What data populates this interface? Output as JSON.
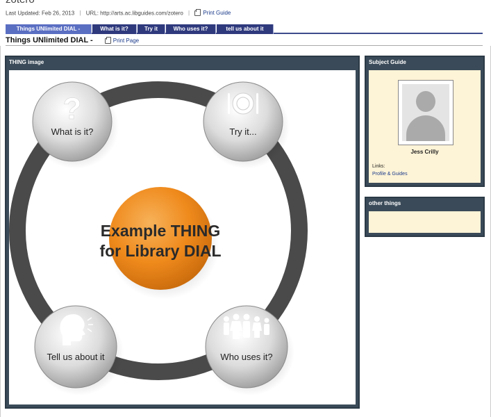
{
  "page": {
    "title": "zotero",
    "last_updated": "Last Updated: Feb 26, 2013",
    "url": "URL: http://arts.ac.libguides.com/zotero",
    "print_guide": "Print Guide"
  },
  "tabs": [
    {
      "label": "Things UNlimited DIAL -",
      "active": true
    },
    {
      "label": "What is it?",
      "active": false
    },
    {
      "label": "Try it",
      "active": false
    },
    {
      "label": "Who uses it?",
      "active": false
    },
    {
      "label": "tell us about it",
      "active": false
    }
  ],
  "subheader": {
    "title": "Things UNlimited DIAL -",
    "print_page": "Print Page"
  },
  "thing_box": {
    "header": "THING image",
    "center_line1": "Example THING",
    "center_line2": "for Library DIAL",
    "nodes": {
      "what": "What is it?",
      "try": "Try it...",
      "tell": "Tell us about it",
      "who": "Who uses it?"
    },
    "colors": {
      "ring": "#4a4a4a",
      "center": "#ef8a1c",
      "header_bg": "#3a4a58"
    }
  },
  "subject_box": {
    "header": "Subject Guide",
    "name": "Jess Crilly",
    "links_label": "Links:",
    "links_value": "Profile & Guides"
  },
  "other_box": {
    "header": "other things"
  }
}
